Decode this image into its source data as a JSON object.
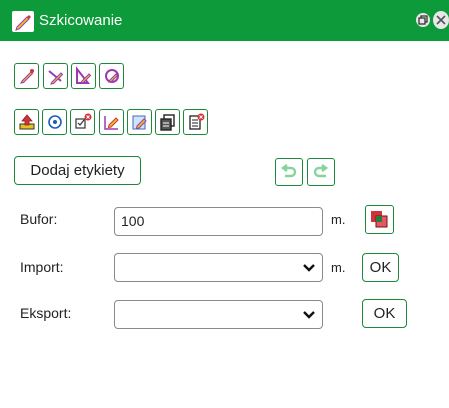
{
  "window": {
    "title": "Szkicowanie",
    "icon": "pencil-icon",
    "controls": [
      "restore-icon",
      "close-icon"
    ]
  },
  "toolbar_row1": {
    "tools": [
      "draw-point-icon",
      "draw-line-icon",
      "draw-polygon-icon",
      "draw-circle-icon"
    ]
  },
  "toolbar_row2": {
    "tools": [
      "upload-icon",
      "target-icon",
      "delete-selected-icon",
      "edit-icon",
      "edit-note-icon",
      "copy-icon",
      "delete-all-icon"
    ]
  },
  "labels_button": {
    "label": "Dodaj etykiety"
  },
  "history": {
    "undo": "undo-icon",
    "redo": "redo-icon"
  },
  "buffer": {
    "label": "Bufor:",
    "value": "100",
    "unit": "m.",
    "button_icon": "buffer-icon"
  },
  "import": {
    "label": "Import:",
    "value": "",
    "unit": "m.",
    "ok_label": "OK"
  },
  "export": {
    "label": "Eksport:",
    "value": "",
    "ok_label": "OK"
  },
  "colors": {
    "accent": "#0c9a3a",
    "border": "#1b8a3a",
    "danger": "#d0343a",
    "purple": "#9b3ab3",
    "yellow": "#e7c21f"
  }
}
